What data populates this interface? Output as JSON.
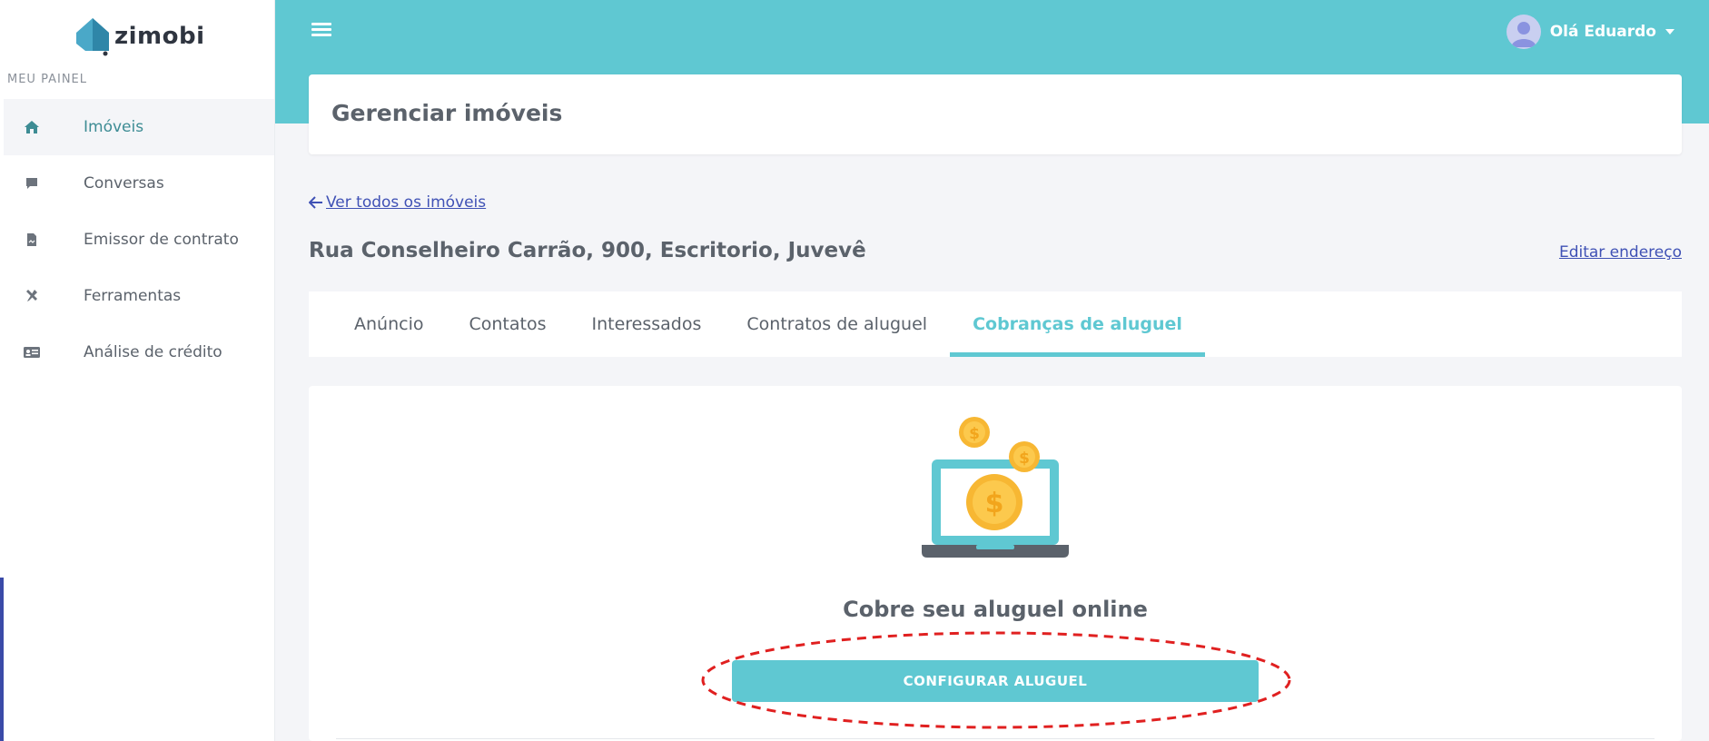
{
  "brand": {
    "name": "zimobi"
  },
  "sidebar": {
    "section_label": "MEU PAINEL",
    "items": [
      {
        "label": "Imóveis",
        "icon": "home-icon",
        "active": true
      },
      {
        "label": "Conversas",
        "icon": "chat-icon",
        "active": false
      },
      {
        "label": "Emissor de contrato",
        "icon": "file-contract-icon",
        "active": false
      },
      {
        "label": "Ferramentas",
        "icon": "tools-icon",
        "active": false
      },
      {
        "label": "Análise de crédito",
        "icon": "id-card-icon",
        "active": false
      }
    ]
  },
  "header": {
    "menu_icon": "hamburger-icon",
    "user_greeting": "Olá Eduardo",
    "colors": {
      "header_bg": "#5fc8d2"
    }
  },
  "page": {
    "title": "Gerenciar imóveis",
    "back_link": "Ver todos os imóveis",
    "address": "Rua Conselheiro Carrão, 900, Escritorio, Juvevê",
    "edit_link": "Editar endereço"
  },
  "tabs": [
    {
      "label": "Anúncio",
      "active": false
    },
    {
      "label": "Contatos",
      "active": false
    },
    {
      "label": "Interessados",
      "active": false
    },
    {
      "label": "Contratos de aluguel",
      "active": false
    },
    {
      "label": "Cobranças de aluguel",
      "active": true
    }
  ],
  "content": {
    "illustration": "laptop-coins-illustration",
    "title": "Cobre seu aluguel online",
    "button_label": "CONFIGURAR ALUGUEL",
    "annotation": "red-dashed-ellipse-highlight"
  },
  "colors": {
    "accent": "#5fc8d2",
    "link": "#3f51b5",
    "text": "#5b626b",
    "highlight": "#e02020"
  }
}
